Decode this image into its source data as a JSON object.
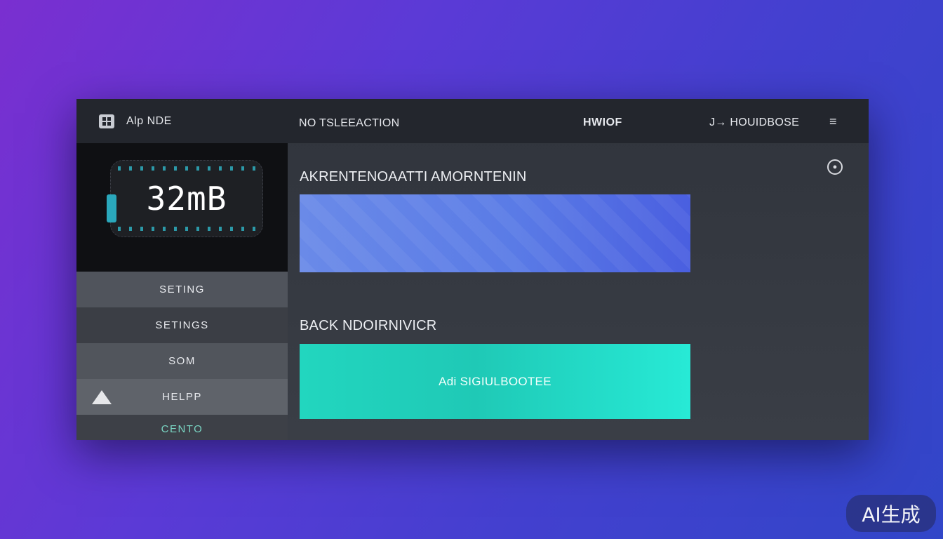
{
  "app": {
    "name": "Alp NDE"
  },
  "logo": {
    "text": "32mB"
  },
  "sidebar": {
    "items": [
      {
        "label": "SETING"
      },
      {
        "label": "SETINGS"
      },
      {
        "label": "SOM"
      },
      {
        "label": "HELPP"
      },
      {
        "label": "CENTO"
      }
    ]
  },
  "topbar": {
    "title": "NO TSLEEACTION",
    "center": "HWIOF",
    "user": "J→ HOUIDBOSE",
    "menu_icon": "menu-icon"
  },
  "main": {
    "section1_label": "AKRENTENOAATTI AMORNTENIN",
    "section2_label": "BACK NDOIRNIVICR",
    "teal_button_label": "Adi SIGIULBOOTEE"
  },
  "badge": {
    "text": "AI生成"
  },
  "colors": {
    "accent_blue": "#5a7be6",
    "accent_teal": "#22d6bf",
    "sidebar_dark": "#16181d",
    "topbar": "#23262d"
  }
}
